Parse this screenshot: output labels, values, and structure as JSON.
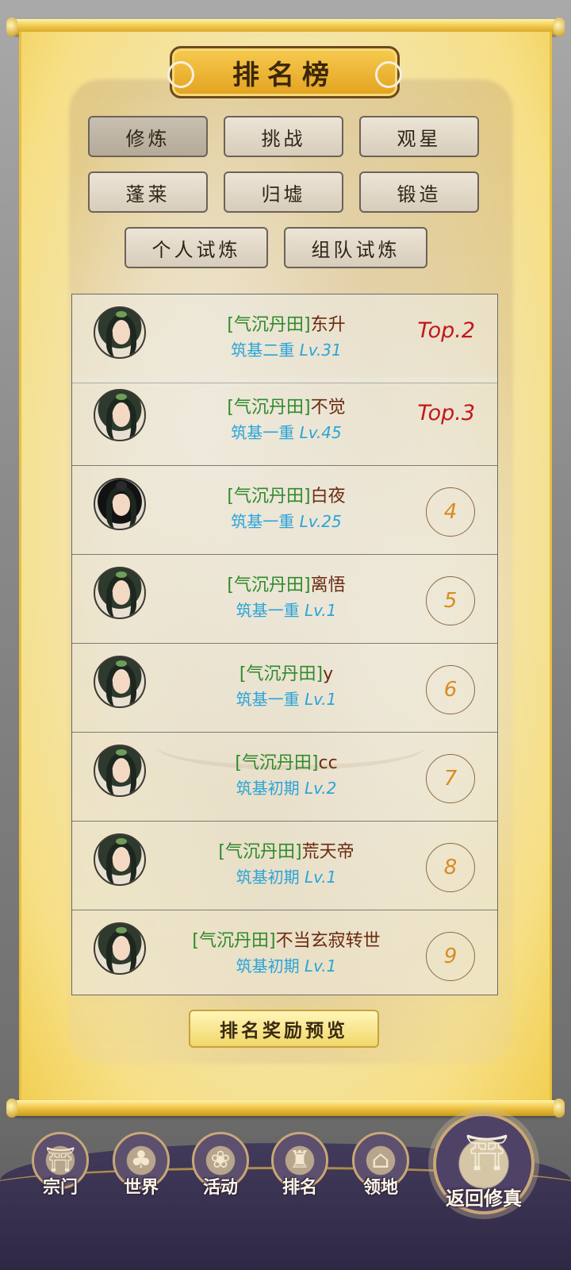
{
  "title": "排名榜",
  "tabs": [
    "修炼",
    "挑战",
    "观星",
    "蓬莱",
    "归墟",
    "锻造",
    "个人试炼",
    "组队试炼"
  ],
  "active_tab": "修炼",
  "rankings": [
    {
      "tag": "[气沉丹田]",
      "name": "东升",
      "realm": "筑基二重",
      "level": "Lv.31",
      "rank": "Top.2",
      "avatar": "female-avatar"
    },
    {
      "tag": "[气沉丹田]",
      "name": "不觉",
      "realm": "筑基一重",
      "level": "Lv.45",
      "rank": "Top.3",
      "avatar": "female-avatar"
    },
    {
      "tag": "[气沉丹田]",
      "name": "白夜",
      "realm": "筑基一重",
      "level": "Lv.25",
      "rank": "4",
      "avatar": "male-avatar"
    },
    {
      "tag": "[气沉丹田]",
      "name": "离悟",
      "realm": "筑基一重",
      "level": "Lv.1",
      "rank": "5",
      "avatar": "female-avatar"
    },
    {
      "tag": "[气沉丹田]",
      "name": "y",
      "realm": "筑基一重",
      "level": "Lv.1",
      "rank": "6",
      "avatar": "female-avatar"
    },
    {
      "tag": "[气沉丹田]",
      "name": "cc",
      "realm": "筑基初期",
      "level": "Lv.2",
      "rank": "7",
      "avatar": "female-avatar"
    },
    {
      "tag": "[气沉丹田]",
      "name": "荒天帝",
      "realm": "筑基初期",
      "level": "Lv.1",
      "rank": "8",
      "avatar": "female-avatar"
    },
    {
      "tag": "[气沉丹田]",
      "name": "不当玄寂转世",
      "realm": "筑基初期",
      "level": "Lv.1",
      "rank": "9",
      "avatar": "female-avatar"
    }
  ],
  "reward_preview": "排名奖励预览",
  "nav": [
    {
      "label": "宗门",
      "icon": "pavilion-icon",
      "glyph": "⛩"
    },
    {
      "label": "世界",
      "icon": "tree-icon",
      "glyph": "♣"
    },
    {
      "label": "活动",
      "icon": "gift-icon",
      "glyph": "❀"
    },
    {
      "label": "排名",
      "icon": "banner-icon",
      "glyph": "♜"
    },
    {
      "label": "领地",
      "icon": "territory-icon",
      "glyph": "⌂"
    }
  ],
  "return_button": {
    "label": "返回修真",
    "icon": "gate-icon",
    "glyph": "⛩"
  },
  "colors": {
    "tag": "#2f8a2a",
    "name": "#6b2a10",
    "realm": "#2aa4d8",
    "top_rank": "#c2171b",
    "rank_number": "#d98a22",
    "scroll_gold": "#f1c84a"
  }
}
